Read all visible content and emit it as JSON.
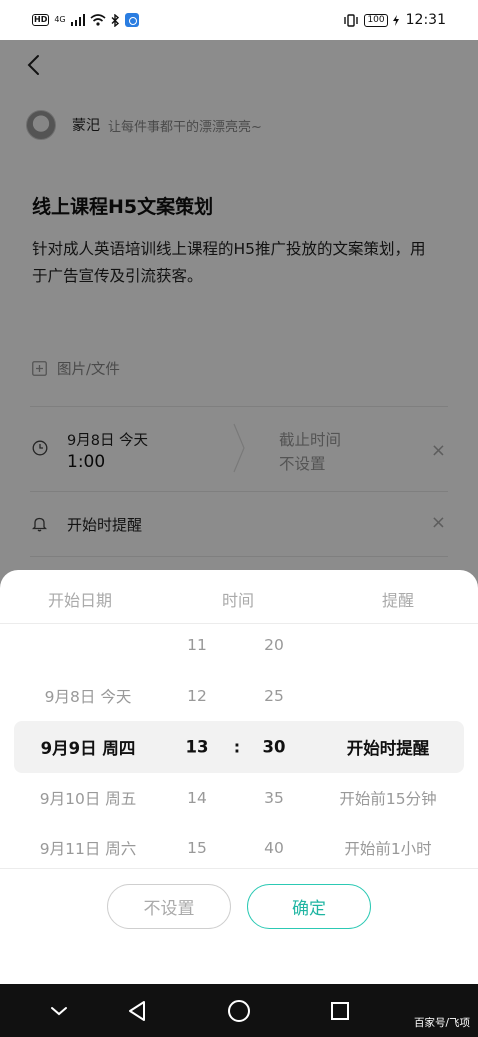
{
  "status_bar": {
    "hd": "HD",
    "network": "4G",
    "battery": "100",
    "time": "12:31"
  },
  "author": {
    "name": "蒙汜",
    "signature": "让每件事都干的漂漂亮亮~"
  },
  "task": {
    "title": "线上课程H5文案策划",
    "description": "针对成人英语培训线上课程的H5推广投放的文案策划，用于广告宣传及引流获客。",
    "attachment_label": "图片/文件",
    "start_date": "9月8日 今天",
    "start_time": "1:00",
    "deadline_label": "截止时间",
    "deadline_value": "不设置",
    "reminder_label": "开始时提醒",
    "close_glyph": "×"
  },
  "picker": {
    "headers": {
      "date": "开始日期",
      "time": "时间",
      "reminder": "提醒"
    },
    "dates": [
      "9月8日 今天",
      "9月9日 周四",
      "9月10日 周五",
      "9月11日 周六"
    ],
    "hours": [
      "11",
      "12",
      "13",
      "14",
      "15"
    ],
    "minutes": [
      "20",
      "25",
      "30",
      "35",
      "40"
    ],
    "reminders": [
      "开始时提醒",
      "开始前15分钟",
      "开始前1小时"
    ],
    "separator": ":",
    "selected": {
      "date": "9月9日 周四",
      "hour": "13",
      "minute": "30",
      "reminder": "开始时提醒"
    },
    "clear_label": "不设置",
    "confirm_label": "确定"
  },
  "watermark": "百家号/飞项",
  "colors": {
    "accent": "#1fb5a2",
    "overlay": "rgba(0,0,0,0.45)",
    "highlight": "#f2f2f2"
  },
  "icons": [
    "back-icon",
    "clock-icon",
    "bell-icon",
    "add-file-icon",
    "close-icon",
    "nav-back-icon",
    "nav-home-icon",
    "nav-recents-icon",
    "nav-down-icon"
  ]
}
